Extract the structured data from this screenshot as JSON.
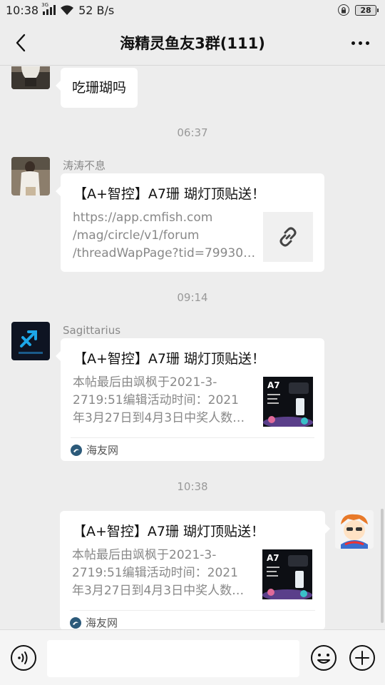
{
  "status_bar": {
    "time": "10:38",
    "net_type": "3G",
    "net_speed": "52 B/s",
    "battery": "28"
  },
  "nav": {
    "title": "海精灵鱼友3群(111)"
  },
  "chat": {
    "msg1": {
      "text": "吃珊瑚吗"
    },
    "time1": "06:37",
    "msg2": {
      "sender": "涛涛不息",
      "title": "【A+智控】A7珊 瑚灯顶贴送！",
      "desc": [
        "https://app.cmfish.com",
        "/mag/circle/v1/forum",
        "/threadWapPage?tid=79930…"
      ],
      "thumb_icon": "link-icon"
    },
    "time2": "09:14",
    "msg3": {
      "sender": "Sagittarius",
      "title": "【A+智控】A7珊 瑚灯顶贴送！",
      "desc": [
        "本帖最后由飒枫于2021-3-",
        "2719:51编辑活动时间：2021",
        "年3月27日到4月3日中奖人数…"
      ],
      "thumb_label": "A7",
      "source": "海友网"
    },
    "time3": "10:38",
    "msg4": {
      "title": "【A+智控】A7珊 瑚灯顶贴送！",
      "desc": [
        "本帖最后由飒枫于2021-3-",
        "2719:51编辑活动时间：2021",
        "年3月27日到4月3日中奖人数…"
      ],
      "thumb_label": "A7",
      "source": "海友网"
    }
  },
  "input": {
    "value": "",
    "placeholder": ""
  },
  "colors": {
    "background": "#ededed",
    "bubble": "#ffffff",
    "time_text": "#999999",
    "source_logo": "#2c5a7a"
  }
}
